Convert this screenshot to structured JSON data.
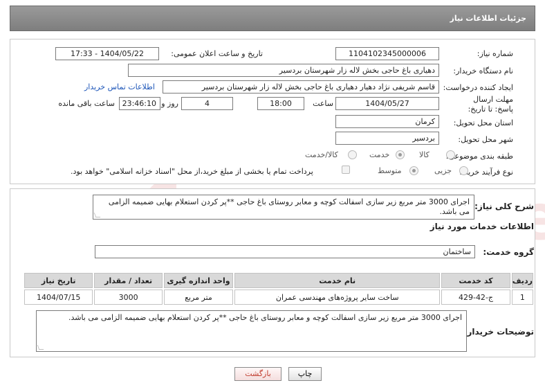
{
  "header": {
    "title": "جزئیات اطلاعات نیاز"
  },
  "form": {
    "need_number_label": "شماره نیاز:",
    "need_number": "1104102345000006",
    "announce_label": "تاریخ و ساعت اعلان عمومی:",
    "announce_value": "1404/05/22 - 17:33",
    "buyer_org_label": "نام دستگاه خریدار:",
    "buyer_org": "دهیاری باغ حاجی بخش لاله زار شهرستان بردسیر",
    "creator_label": "ایجاد کننده درخواست:",
    "creator": "قاسم شریفی نژاد دهیار دهیاری باغ حاجی بخش لاله زار شهرستان بردسیر",
    "contact_link": "اطلاعات تماس خریدار",
    "deadline_label": "مهلت ارسال پاسخ: تا تاریخ:",
    "deadline_date": "1404/05/27",
    "time_label": "ساعت",
    "deadline_time": "18:00",
    "days_value": "4",
    "days_label": "روز و",
    "remaining_time": "23:46:10",
    "remaining_label": "ساعت باقی مانده",
    "province_label": "استان محل تحویل:",
    "province": "کرمان",
    "city_label": "شهر محل تحویل:",
    "city": "بردسیر",
    "category_label": "طبقه بندی موضوعی:",
    "category_options": [
      "کالا",
      "خدمت",
      "کالا/خدمت"
    ],
    "category_selected": "خدمت",
    "process_label": "نوع فرآیند خرید :",
    "process_options": [
      "جزیی",
      "متوسط"
    ],
    "process_selected": "متوسط",
    "payment_note": "پرداخت تمام یا بخشی از مبلغ خرید،از محل \"اسناد خزانه اسلامی\" خواهد بود."
  },
  "description": {
    "label": "شرح کلی نیاز:",
    "text": "اجرای 3000 متر مربع زیر سازی اسفالت کوچه و معابر روستای باغ حاجی **پر کردن استعلام بهایی ضمیمه الزامی می باشد."
  },
  "services": {
    "section_title": "اطلاعات خدمات مورد نیاز",
    "group_label": "گروه خدمت:",
    "group_value": "ساختمان",
    "columns": [
      "ردیف",
      "کد خدمت",
      "نام خدمت",
      "واحد اندازه گیری",
      "تعداد / مقدار",
      "تاریخ نیاز"
    ],
    "rows": [
      [
        "1",
        "ج-42-429",
        "ساخت سایر پروژه‌های مهندسی عمران",
        "متر مربع",
        "3000",
        "1404/07/15"
      ]
    ]
  },
  "buyer_notes": {
    "label": "توضیحات خریدار:",
    "text": "اجرای 3000 متر مربع زیر سازی اسفالت کوچه و معابر روستای باغ حاجی **پر کردن استعلام بهایی ضمیمه الزامی می باشد."
  },
  "buttons": {
    "print": "چاپ",
    "back": "بازگشت"
  },
  "watermark": {
    "text": "AriaTender.neT"
  },
  "colors": {
    "link": "#1c55b8",
    "title_bar": "#8a8a8a",
    "back_button_text": "#c0392b"
  }
}
